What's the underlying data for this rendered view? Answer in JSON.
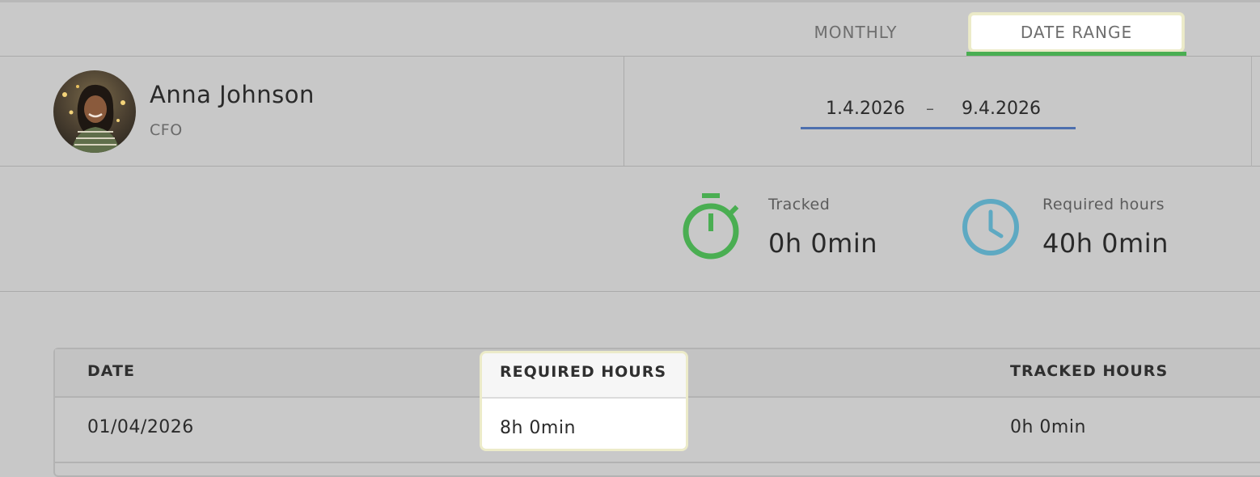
{
  "tabs": {
    "monthly": "MONTHLY",
    "date_range": "DATE RANGE",
    "active": "DATE RANGE",
    "active_underline_color": "#4aae52"
  },
  "profile": {
    "name": "Anna Johnson",
    "role": "CFO",
    "avatar": "avatar-photo"
  },
  "date_range": {
    "start": "1.4.2026",
    "separator": "–",
    "end": "9.4.2026"
  },
  "stats": {
    "tracked": {
      "label": "Tracked",
      "value": "0h 0min",
      "icon": "stopwatch-icon",
      "color": "#4aae52"
    },
    "required": {
      "label": "Required hours",
      "value": "40h 0min",
      "icon": "clock-icon",
      "color": "#5ea9c2"
    }
  },
  "table": {
    "columns": [
      "DATE",
      "REQUIRED HOURS",
      "TRACKED HOURS"
    ],
    "rows": [
      [
        "01/04/2026",
        "8h 0min",
        "0h 0min"
      ]
    ]
  }
}
